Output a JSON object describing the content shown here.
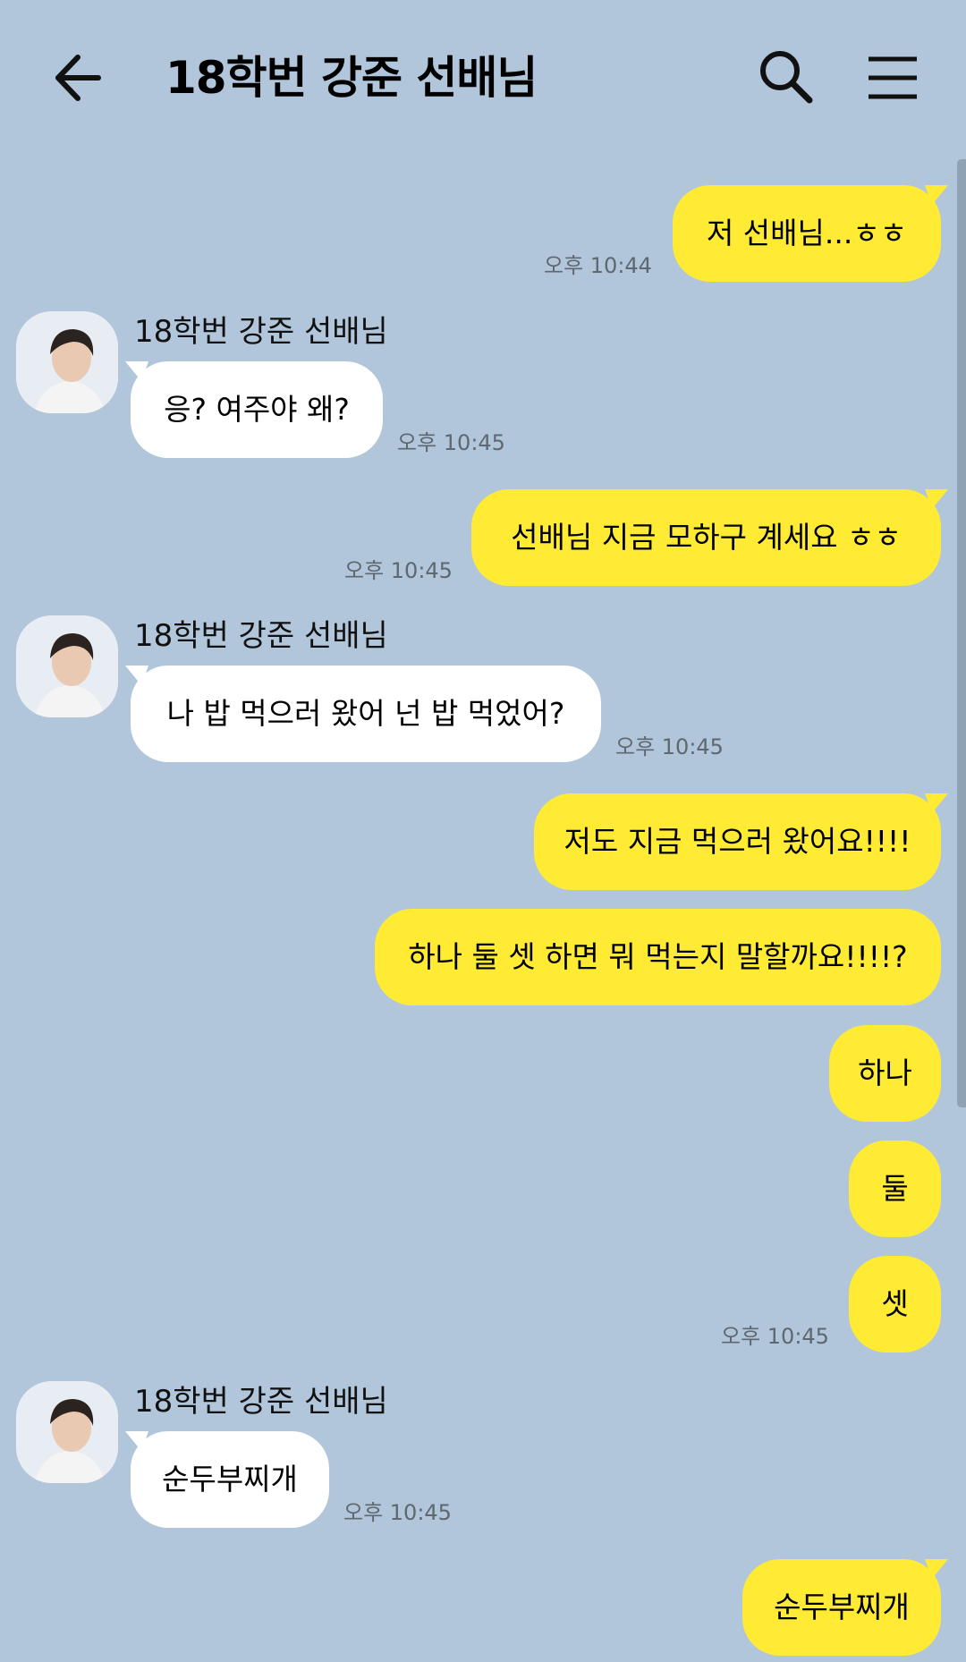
{
  "header": {
    "title": "18학번 강준 선배님",
    "back_icon": "arrow-left-icon",
    "search_icon": "search-icon",
    "menu_icon": "hamburger-menu-icon"
  },
  "colors": {
    "background": "#b1c6da",
    "my_bubble": "#ffeb33",
    "other_bubble": "#ffffff",
    "timestamp": "#5f6770"
  },
  "messages": [
    {
      "sender": "me",
      "text": "저 선배님...ㅎㅎ",
      "time": "오후 10:44"
    },
    {
      "sender": "other",
      "name": "18학번 강준 선배님",
      "text": "응? 여주야 왜?",
      "time": "오후 10:45"
    },
    {
      "sender": "me",
      "text": "선배님 지금 모하구 계세요 ㅎㅎ",
      "time": "오후 10:45"
    },
    {
      "sender": "other",
      "name": "18학번 강준 선배님",
      "text": "나 밥 먹으러 왔어 넌 밥 먹었어?",
      "time": "오후 10:45"
    },
    {
      "sender": "me",
      "text": "저도 지금 먹으러 왔어요!!!!"
    },
    {
      "sender": "me",
      "text": "하나 둘 셋 하면 뭐 먹는지 말할까요!!!!?"
    },
    {
      "sender": "me",
      "text": "하나"
    },
    {
      "sender": "me",
      "text": "둘"
    },
    {
      "sender": "me",
      "text": "셋",
      "time": "오후 10:45"
    },
    {
      "sender": "other",
      "name": "18학번 강준 선배님",
      "text": "순두부찌개",
      "time": "오후 10:45"
    },
    {
      "sender": "me",
      "text": "순두부찌개"
    }
  ]
}
